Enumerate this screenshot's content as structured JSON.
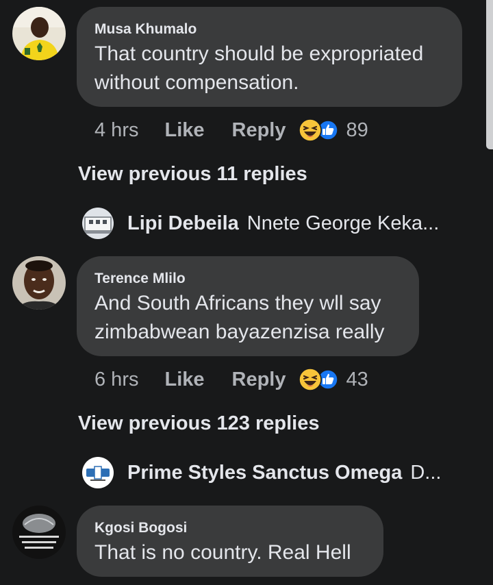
{
  "comments": [
    {
      "author": "Musa Khumalo",
      "text": "That country should be expropriated without compensation.",
      "time": "4 hrs",
      "like_label": "Like",
      "reply_label": "Reply",
      "reaction_count": "89",
      "reaction_icons": [
        "haha-icon",
        "like-icon"
      ],
      "view_previous": "View previous 11 replies",
      "latest_reply": {
        "author": "Lipi Debeila",
        "text": "Nnete George Keka..."
      }
    },
    {
      "author": "Terence Mlilo",
      "text": "And South Africans they wll say zimbabwean bayazenzisa really",
      "time": "6 hrs",
      "like_label": "Like",
      "reply_label": "Reply",
      "reaction_count": "43",
      "reaction_icons": [
        "haha-icon",
        "like-icon"
      ],
      "view_previous": "View previous 123 replies",
      "latest_reply": {
        "author": "Prime Styles Sanctus Omega",
        "text": "D..."
      }
    },
    {
      "author": "Kgosi Bogosi",
      "text": "That is no country. Real Hell"
    }
  ],
  "colors": {
    "background": "#18191a",
    "bubble": "#3a3b3c",
    "primary_text": "#e4e6eb",
    "secondary_text": "#b0b3b8",
    "like_blue": "#1877f2",
    "haha_yellow": "#f7c43a"
  }
}
